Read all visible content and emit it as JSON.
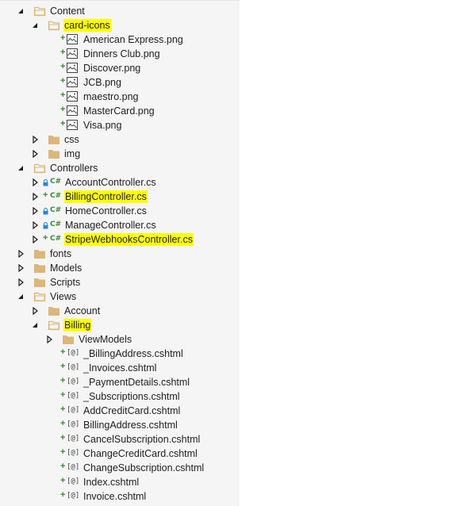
{
  "tree": [
    {
      "label": "Content",
      "level": 0,
      "kind": "folder",
      "state": "expanded",
      "highlight": false,
      "status": null
    },
    {
      "label": "card-icons",
      "level": 1,
      "kind": "folder",
      "state": "expanded",
      "highlight": true,
      "status": null
    },
    {
      "label": "American Express.png",
      "level": 2,
      "kind": "image",
      "state": "leaf",
      "highlight": false,
      "status": "added"
    },
    {
      "label": "Dinners Club.png",
      "level": 2,
      "kind": "image",
      "state": "leaf",
      "highlight": false,
      "status": "added"
    },
    {
      "label": "Discover.png",
      "level": 2,
      "kind": "image",
      "state": "leaf",
      "highlight": false,
      "status": "added"
    },
    {
      "label": "JCB.png",
      "level": 2,
      "kind": "image",
      "state": "leaf",
      "highlight": false,
      "status": "added"
    },
    {
      "label": "maestro.png",
      "level": 2,
      "kind": "image",
      "state": "leaf",
      "highlight": false,
      "status": "added"
    },
    {
      "label": "MasterCard.png",
      "level": 2,
      "kind": "image",
      "state": "leaf",
      "highlight": false,
      "status": "added"
    },
    {
      "label": "Visa.png",
      "level": 2,
      "kind": "image",
      "state": "leaf",
      "highlight": false,
      "status": "added"
    },
    {
      "label": "css",
      "level": 1,
      "kind": "folder",
      "state": "collapsed",
      "highlight": false,
      "status": null
    },
    {
      "label": "img",
      "level": 1,
      "kind": "folder",
      "state": "collapsed",
      "highlight": false,
      "status": null
    },
    {
      "label": "Controllers",
      "level": 0,
      "kind": "folder",
      "state": "expanded",
      "highlight": false,
      "status": null
    },
    {
      "label": "AccountController.cs",
      "level": 1,
      "kind": "csharp",
      "state": "collapsed",
      "highlight": false,
      "status": "locked"
    },
    {
      "label": "BillingController.cs",
      "level": 1,
      "kind": "csharp",
      "state": "collapsed",
      "highlight": true,
      "status": "added"
    },
    {
      "label": "HomeController.cs",
      "level": 1,
      "kind": "csharp",
      "state": "collapsed",
      "highlight": false,
      "status": "locked"
    },
    {
      "label": "ManageController.cs",
      "level": 1,
      "kind": "csharp",
      "state": "collapsed",
      "highlight": false,
      "status": "locked"
    },
    {
      "label": "StripeWebhooksController.cs",
      "level": 1,
      "kind": "csharp",
      "state": "collapsed",
      "highlight": true,
      "status": "added"
    },
    {
      "label": "fonts",
      "level": 0,
      "kind": "folder",
      "state": "collapsed",
      "highlight": false,
      "status": null
    },
    {
      "label": "Models",
      "level": 0,
      "kind": "folder",
      "state": "collapsed",
      "highlight": false,
      "status": null
    },
    {
      "label": "Scripts",
      "level": 0,
      "kind": "folder",
      "state": "collapsed",
      "highlight": false,
      "status": null
    },
    {
      "label": "Views",
      "level": 0,
      "kind": "folder",
      "state": "expanded",
      "highlight": false,
      "status": null
    },
    {
      "label": "Account",
      "level": 1,
      "kind": "folder",
      "state": "collapsed",
      "highlight": false,
      "status": null
    },
    {
      "label": "Billing",
      "level": 1,
      "kind": "folder",
      "state": "expanded",
      "highlight": true,
      "status": null
    },
    {
      "label": "ViewModels",
      "level": 2,
      "kind": "folder",
      "state": "collapsed",
      "highlight": false,
      "status": null
    },
    {
      "label": "_BillingAddress.cshtml",
      "level": 2,
      "kind": "razor",
      "state": "leaf",
      "highlight": false,
      "status": "added"
    },
    {
      "label": "_Invoices.cshtml",
      "level": 2,
      "kind": "razor",
      "state": "leaf",
      "highlight": false,
      "status": "added"
    },
    {
      "label": "_PaymentDetails.cshtml",
      "level": 2,
      "kind": "razor",
      "state": "leaf",
      "highlight": false,
      "status": "added"
    },
    {
      "label": "_Subscriptions.cshtml",
      "level": 2,
      "kind": "razor",
      "state": "leaf",
      "highlight": false,
      "status": "added"
    },
    {
      "label": "AddCreditCard.cshtml",
      "level": 2,
      "kind": "razor",
      "state": "leaf",
      "highlight": false,
      "status": "added"
    },
    {
      "label": "BillingAddress.cshtml",
      "level": 2,
      "kind": "razor",
      "state": "leaf",
      "highlight": false,
      "status": "added"
    },
    {
      "label": "CancelSubscription.cshtml",
      "level": 2,
      "kind": "razor",
      "state": "leaf",
      "highlight": false,
      "status": "added"
    },
    {
      "label": "ChangeCreditCard.cshtml",
      "level": 2,
      "kind": "razor",
      "state": "leaf",
      "highlight": false,
      "status": "added"
    },
    {
      "label": "ChangeSubscription.cshtml",
      "level": 2,
      "kind": "razor",
      "state": "leaf",
      "highlight": false,
      "status": "added"
    },
    {
      "label": "Index.cshtml",
      "level": 2,
      "kind": "razor",
      "state": "leaf",
      "highlight": false,
      "status": "added"
    },
    {
      "label": "Invoice.cshtml",
      "level": 2,
      "kind": "razor",
      "state": "leaf",
      "highlight": false,
      "status": "added"
    }
  ],
  "glyphs": {
    "added": "+",
    "locked": "🔒",
    "csharp": "C#",
    "razor": "[@]"
  },
  "colors": {
    "highlight": "#ffff00",
    "folder": "#dcb67a",
    "added": "#388a34",
    "locked": "#1e88e5",
    "csharp": "#388a34"
  }
}
